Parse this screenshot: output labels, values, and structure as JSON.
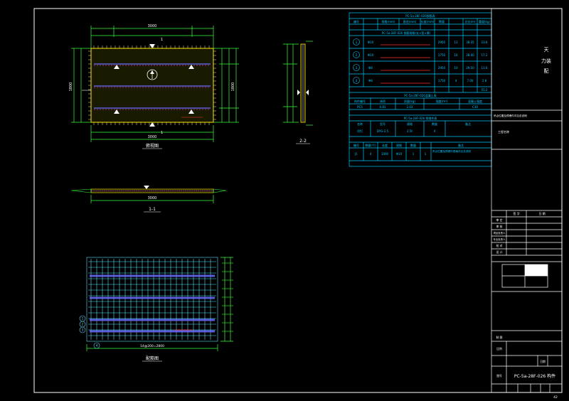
{
  "colors": {
    "background": "#000000",
    "frame": "#ffffff",
    "table": "#00c8ff",
    "panel_fill": "#1a1a00",
    "panel_edge": "#d8c400",
    "bar_blue": "#6a6cff",
    "bar_magenta": "#ff40ff",
    "dimension": "#38ff38",
    "leader_red": "#ff3030",
    "grid_cyan": "#60e0ff"
  },
  "drawing": {
    "plan_title": "俯视图",
    "section_2_title": "2-2",
    "section_1_title": "1-1",
    "rebar_title": "配筋图",
    "dim_plan_total": "3000",
    "dim_plan_bottom": "3000",
    "dim_plan_height": "1800",
    "dim_side": "180",
    "dim_section_length": "3000",
    "dim_rebar_bottom": "14@200=2800",
    "section_mark": "1",
    "bar_labels": [
      "1",
      "2",
      "3",
      "4"
    ]
  },
  "tables": {
    "rebar_table_title": "PC-5a-28F-026钢筋表",
    "rebar_headers": [
      "编号",
      "规格(mm)",
      "直径(mm)",
      "长度(mm)",
      "数量",
      "总长(m)",
      "重量(kg)"
    ],
    "rebar_subhead": "PC-5a-28F-026 钢筋规格(长×宽×厚)",
    "rebar_rows": [
      [
        "1",
        "Φ10",
        "2950",
        "13",
        "38.35",
        "23.6"
      ],
      [
        "2",
        "Φ10",
        "1750",
        "16",
        "28.00",
        "17.2"
      ],
      [
        "3",
        "Φ8",
        "2950",
        "10",
        "29.50",
        "11.6"
      ],
      [
        "4",
        "Φ8",
        "1750",
        "4",
        "7.00",
        "2.8"
      ]
    ],
    "rebar_total": "55.2",
    "concrete_title": "PC-5a-28F-026混凝土表",
    "concrete_headers": [
      "构件编号",
      "体积",
      "质量(kg)",
      "强度(m³)",
      "混凝土强度"
    ],
    "concrete_row": [
      "PC5",
      "0.81",
      "2.03",
      "C30"
    ],
    "embed_title": "PC-5a-28F-026 预埋件表",
    "embed_headers": [
      "名称",
      "型号",
      "规格",
      "数量",
      "备注"
    ],
    "embed_row": [
      "吊钉",
      "DYG-2.5",
      "2.5t",
      "4"
    ],
    "note_headers": [
      "编号",
      "数量(个)",
      "长度",
      "规格",
      "数量",
      "备注"
    ],
    "note_row": [
      "J1",
      "4",
      "1000",
      "Φ10",
      "1",
      "1"
    ],
    "note_text": "吊点位置及预埋件规格详见总说明",
    "side_note": "吊点位置及预埋件详见总说明"
  },
  "titleblock": {
    "company_line1": "天",
    "company_line2": "力装",
    "company_line3": "配",
    "project_label": "工程名称",
    "rows": [
      "审 定",
      "审 核",
      "项目负责人",
      "专业负责人",
      "校 对",
      "设 计",
      "制 图"
    ],
    "col_heads": [
      "签 字",
      "日 期"
    ],
    "drawing_title": "PC-5a-28F-026 构件",
    "sheet_label": "图号",
    "scale_label": "比例",
    "date_label": "日期",
    "sheet_no": "42"
  }
}
